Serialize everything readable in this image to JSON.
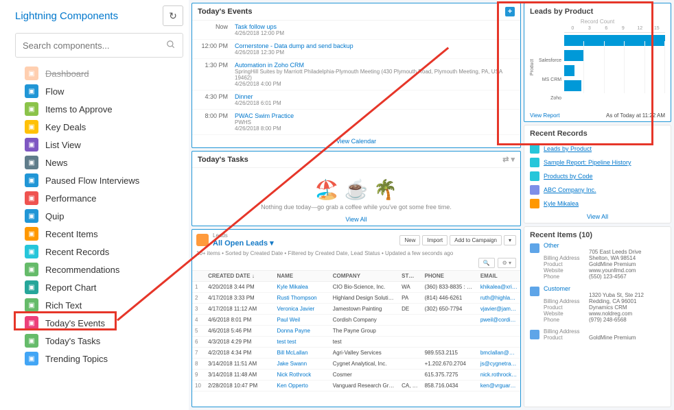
{
  "sidebar": {
    "title": "Lightning Components",
    "search_placeholder": "Search components...",
    "items": [
      {
        "label": "Dashboard",
        "color": "#ff8a3d",
        "cut": true
      },
      {
        "label": "Flow",
        "color": "#2196d6"
      },
      {
        "label": "Items to Approve",
        "color": "#8bc34a"
      },
      {
        "label": "Key Deals",
        "color": "#ffc107"
      },
      {
        "label": "List View",
        "color": "#7e57c2"
      },
      {
        "label": "News",
        "color": "#607d8b"
      },
      {
        "label": "Paused Flow Interviews",
        "color": "#2196d6"
      },
      {
        "label": "Performance",
        "color": "#ef5350"
      },
      {
        "label": "Quip",
        "color": "#2196d6"
      },
      {
        "label": "Recent Items",
        "color": "#ff9800"
      },
      {
        "label": "Recent Records",
        "color": "#26c6da"
      },
      {
        "label": "Recommendations",
        "color": "#66bb6a"
      },
      {
        "label": "Report Chart",
        "color": "#26a69a"
      },
      {
        "label": "Rich Text",
        "color": "#66bb6a"
      },
      {
        "label": "Today's Events",
        "color": "#ec407a"
      },
      {
        "label": "Today's Tasks",
        "color": "#66bb6a"
      },
      {
        "label": "Trending Topics",
        "color": "#42a5f5"
      }
    ]
  },
  "events": {
    "title": "Today's Events",
    "items": [
      {
        "time": "Now",
        "title": "Task follow ups",
        "sub": "4/26/2018 12:00 PM"
      },
      {
        "time": "12:00 PM",
        "title": "Cornerstone - Data dump and send backup",
        "sub": "4/26/2018 12:30 PM"
      },
      {
        "time": "1:30 PM",
        "title": "Automation in Zoho CRM",
        "sub": "SpringHill Suites by Marriott Philadelphia-Plymouth Meeting (430 Plymouth Road, Plymouth Meeting, PA, USA 19462)",
        "sub2": "4/26/2018 4:00 PM"
      },
      {
        "time": "4:30 PM",
        "title": "Dinner",
        "sub": "4/26/2018 6:01 PM"
      },
      {
        "time": "8:00 PM",
        "title": "PWAC Swim Practice",
        "sub": "PWHS",
        "sub2": "4/26/2018 8:00 PM"
      }
    ],
    "view": "View Calendar"
  },
  "tasks": {
    "title": "Today's Tasks",
    "empty": "Nothing due today—go grab a coffee while you've got some free time.",
    "view": "View All"
  },
  "leads": {
    "kicker": "Leads",
    "title": "All Open Leads",
    "buttons": [
      "New",
      "Import",
      "Add to Campaign"
    ],
    "sub": "10+ items • Sorted by Created Date • Filtered by Created Date, Lead Status • Updated a few seconds ago",
    "cols": [
      "",
      "CREATED DATE",
      "",
      "NAME",
      "",
      "COMPANY",
      "",
      "ST…",
      "",
      "PHONE",
      "",
      "EMAIL"
    ],
    "cols_simple": [
      "",
      "CREATED DATE ↓",
      "NAME",
      "COMPANY",
      "ST…",
      "PHONE",
      "EMAIL"
    ],
    "rows": [
      [
        "1",
        "4/20/2018 3:44 PM",
        "Kyle Mikalea",
        "CIO Bio-Science, Inc.",
        "WA",
        "(360) 833-8835 : 208",
        "khikalea@xri-ord…"
      ],
      [
        "2",
        "4/17/2018 3:33 PM",
        "Rusti Thompson",
        "Highland Design Soluti…",
        "PA",
        "(814) 446-6261",
        "ruth@highlandis…"
      ],
      [
        "3",
        "4/17/2018 11:12 AM",
        "Veronica Javier",
        "Jamestown Painting",
        "DE",
        "(302) 650-7794",
        "vjavier@jamesto…"
      ],
      [
        "4",
        "4/6/2018 8:01 PM",
        "Paul Weil",
        "Cordish Company",
        "",
        "",
        "pweil@cordish.c…"
      ],
      [
        "5",
        "4/6/2018 5:46 PM",
        "Donna Payne",
        "The Payne Group",
        "",
        "",
        ""
      ],
      [
        "6",
        "4/3/2018 4:29 PM",
        "test test",
        "test",
        "",
        "",
        ""
      ],
      [
        "7",
        "4/2/2018 4:34 PM",
        "Bill McLallan",
        "Agri-Valley Services",
        "",
        "989.553.2115",
        "bmclallan@wc…"
      ],
      [
        "8",
        "3/14/2018 11:51 AM",
        "Jake Swann",
        "Cygnet Analytical, Inc.",
        "",
        "+1.202.670.2704",
        "js@cygnetrani.c…"
      ],
      [
        "9",
        "3/14/2018 11:48 AM",
        "Nick Rothrock",
        "Cosmer",
        "",
        "615.375.7275",
        "nick.rothrock@c…"
      ],
      [
        "10",
        "2/28/2018 10:47 PM",
        "Ken Opperto",
        "Vanguard Research Gro…",
        "CA, 9…",
        "858.716.0434",
        "ken@vrguardin…"
      ]
    ]
  },
  "chart": {
    "title": "Leads by Product",
    "sub": "Record Count",
    "ylabel": "Product",
    "ticks": [
      "0",
      "3",
      "6",
      "9",
      "12",
      "15"
    ],
    "foot_link": "View Report",
    "foot_time": "As of Today at 11:22 AM"
  },
  "chart_data": {
    "type": "bar",
    "orientation": "horizontal",
    "title": "Leads by Product",
    "xlabel": "Record Count",
    "ylabel": "Product",
    "xlim": [
      0,
      15
    ],
    "categories": [
      "",
      "Salesforce",
      "MS CRM",
      "Zoho"
    ],
    "values": [
      15,
      3,
      1.5,
      2.5
    ]
  },
  "recent_records": {
    "title": "Recent Records",
    "items": [
      {
        "label": "Leads by Product",
        "color": "#26c6da"
      },
      {
        "label": "Sample Report: Pipeline History",
        "color": "#26c6da"
      },
      {
        "label": "Products by Code",
        "color": "#26c6da"
      },
      {
        "label": "ABC Company Inc.",
        "color": "#7e8fe8"
      },
      {
        "label": "Kyle Mikalea",
        "color": "#ff9800"
      }
    ],
    "view": "View All"
  },
  "recent_items": {
    "title": "Recent Items (10)",
    "blocks": [
      {
        "head": "Other",
        "kv": [
          [
            "",
            "705 East Leeds Drive"
          ],
          [
            "Billing Address",
            "Shelton, WA 98514"
          ],
          [
            "Product",
            "GoldMine Premium"
          ],
          [
            "Website",
            "www.younllmd.com"
          ],
          [
            "Phone",
            "(550) 123-4567"
          ]
        ]
      },
      {
        "head": "Customer",
        "kv": [
          [
            "",
            "1320 Yuba St, Ste 212"
          ],
          [
            "Billing Address",
            "Redding, CA 96001"
          ],
          [
            "Product",
            "Dynamics CRM"
          ],
          [
            "Website",
            "www.noldreg.com"
          ],
          [
            "Phone",
            "(979) 248-6568"
          ]
        ]
      },
      {
        "head": "",
        "kv": [
          [
            "Billing Address",
            ""
          ],
          [
            "Product",
            "GoldMine Premium"
          ]
        ]
      }
    ]
  }
}
